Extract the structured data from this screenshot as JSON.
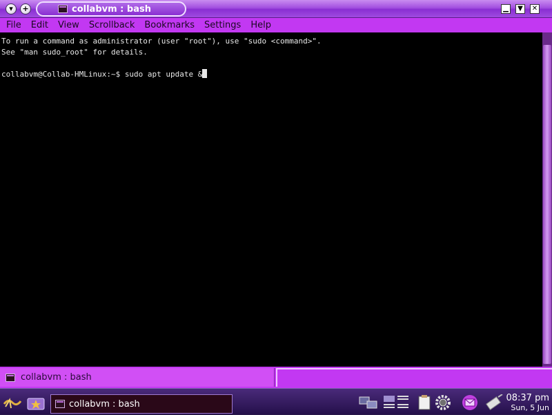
{
  "window": {
    "title": "collabvm : bash"
  },
  "menu": [
    "File",
    "Edit",
    "View",
    "Scrollback",
    "Bookmarks",
    "Settings",
    "Help"
  ],
  "terminal": {
    "lines": [
      "To run a command as administrator (user \"root\"), use \"sudo <command>\".",
      "See \"man sudo_root\" for details.",
      ""
    ],
    "prompt": "collabvm@Collab-HMLinux:~$ ",
    "command": "sudo apt update &"
  },
  "session_tab": {
    "label": "collabvm : bash"
  },
  "taskbar": {
    "task_label": "collabvm : bash",
    "clock_time": "08:37 pm",
    "clock_date": "Sun, 5 Jun"
  },
  "icons": {
    "window_menu": "chevron-down-icon",
    "sticky": "plus-icon",
    "minimize": "minimize-icon",
    "maximize": "maximize-icon",
    "close": "close-icon"
  },
  "colors": {
    "accent": "#c238f2",
    "terminal_bg": "#000000",
    "terminal_fg": "#e8e8e8"
  }
}
